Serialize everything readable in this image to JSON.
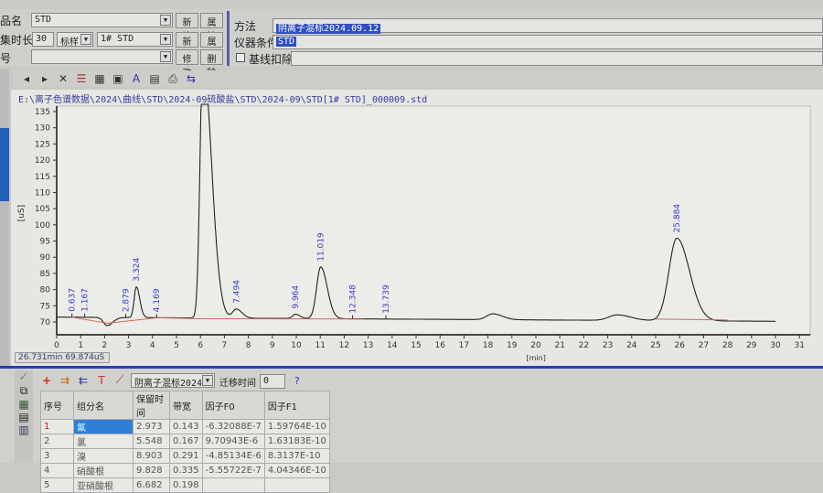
{
  "form": {
    "sample_name_label": "品名",
    "sample_name": "STD",
    "duration_label": "集时长",
    "duration": "30",
    "type": "标样",
    "std_name": "1# STD",
    "number_label": "号",
    "number": "",
    "new_label": "新建",
    "prop_label": "属性",
    "edit_label": "修改",
    "delete_label": "删除",
    "method_label": "方法",
    "method": "阴离子混标2024.09.12",
    "instrument_label": "仪器条件",
    "instrument": "STD",
    "baseline_label": "基线扣除"
  },
  "file_path": "E:\\离子色谱数据\\2024\\曲线\\STD\\2024-09硫酸盐\\STD\\2024-09\\STD[1# STD]_000009.std",
  "status_readout": "26.731min 69.874uS",
  "chart_data": {
    "type": "line",
    "xlabel": "[min]",
    "ylabel": "[uS]",
    "xlim": [
      0,
      31
    ],
    "ylim": [
      70,
      135
    ],
    "xticks": [
      0,
      1,
      2,
      3,
      4,
      5,
      6,
      7,
      8,
      9,
      10,
      11,
      12,
      13,
      14,
      15,
      16,
      17,
      18,
      19,
      20,
      21,
      22,
      23,
      24,
      25,
      26,
      27,
      28,
      29,
      30,
      31
    ],
    "yticks": [
      70,
      75,
      80,
      85,
      90,
      95,
      100,
      105,
      110,
      115,
      120,
      125,
      130,
      135
    ],
    "baseline": 71.5,
    "peaks": [
      {
        "rt": 2.1,
        "height": -2.5,
        "width": 0.15,
        "label": ""
      },
      {
        "rt": 3.324,
        "height": 9.5,
        "width": 0.09,
        "label": "3.324"
      },
      {
        "rt": 6.1,
        "height": 80,
        "width": 0.12,
        "label": ""
      },
      {
        "rt": 7.494,
        "height": 2.8,
        "width": 0.15,
        "label": "7.494"
      },
      {
        "rt": 9.964,
        "height": 1.3,
        "width": 0.12,
        "label": "9.964"
      },
      {
        "rt": 11.019,
        "height": 16,
        "width": 0.17,
        "label": "11.019"
      },
      {
        "rt": 18.2,
        "height": 1.8,
        "width": 0.25,
        "label": ""
      },
      {
        "rt": 23.4,
        "height": 1.7,
        "width": 0.35,
        "label": ""
      },
      {
        "rt": 25.884,
        "height": 25.5,
        "width": 0.33,
        "label": "25.884"
      }
    ],
    "markers": [
      {
        "rt": 0.637,
        "label": "0.637"
      },
      {
        "rt": 1.167,
        "label": "1.167"
      },
      {
        "rt": 2.879,
        "label": "2.879"
      },
      {
        "rt": 4.169,
        "label": "4.169"
      },
      {
        "rt": 12.348,
        "label": "12.348"
      },
      {
        "rt": 13.739,
        "label": "13.739"
      }
    ]
  },
  "peak_table": {
    "method_select": "阴离子混标2024",
    "offset_label": "迁移时间",
    "offset": "0",
    "help": "?",
    "headers": [
      "序号",
      "组分名",
      "保留时间",
      "带宽",
      "因子F0",
      "因子F1"
    ],
    "rows": [
      [
        "1",
        "氟",
        "2.973",
        "0.143",
        "-6.32088E-7",
        "1.59764E-10"
      ],
      [
        "2",
        "氯",
        "5.548",
        "0.167",
        "9.70943E-6",
        "1.63183E-10"
      ],
      [
        "3",
        "溴",
        "8.903",
        "0.291",
        "-4.85134E-6",
        "8.3137E-10"
      ],
      [
        "4",
        "硝酸根",
        "9.828",
        "0.335",
        "-5.55722E-7",
        "4.04346E-10"
      ],
      [
        "5",
        "亚硝酸根",
        "6.682",
        "0.198",
        "",
        ""
      ]
    ]
  }
}
